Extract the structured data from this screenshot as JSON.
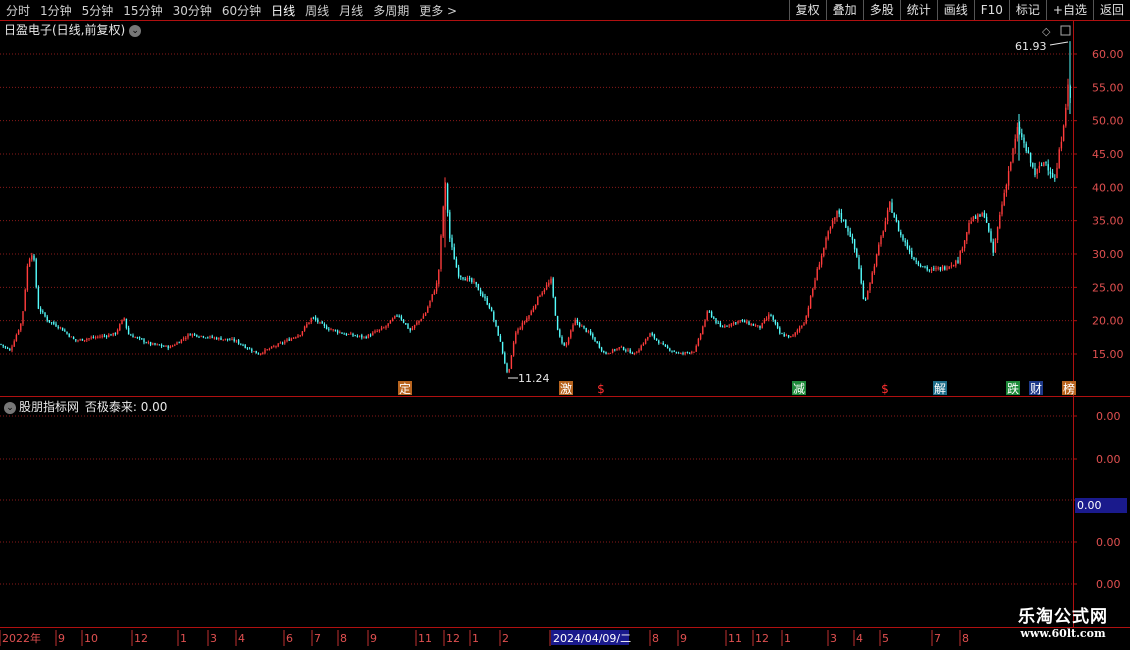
{
  "toolbar": {
    "periods": [
      "分时",
      "1分钟",
      "5分钟",
      "15分钟",
      "30分钟",
      "60分钟",
      "日线",
      "周线",
      "月线",
      "多周期",
      "更多 >"
    ],
    "active_period": "日线",
    "actions": [
      "复权",
      "叠加",
      "多股",
      "统计",
      "画线",
      "F10",
      "标记",
      "+自选",
      "返回"
    ]
  },
  "main_chart": {
    "title": "日盈电子(日线,前复权)",
    "y_ticks": [
      "60.00",
      "55.00",
      "50.00",
      "45.00",
      "40.00",
      "35.00",
      "30.00",
      "25.00",
      "20.00",
      "15.00"
    ],
    "high_label": "61.93",
    "low_label": "11.24",
    "event_markers": [
      "定",
      "激",
      "$",
      "减",
      "$",
      "解",
      "跌",
      "财",
      "榜"
    ]
  },
  "indicator": {
    "title": "股朋指标网",
    "line_label": "否极泰来: 0.00",
    "y_ticks": [
      "0.00",
      "0.00",
      "0.00",
      "0.00",
      "0.00"
    ],
    "current_value": "0.00"
  },
  "x_axis": {
    "labels": [
      "2022年",
      "9",
      "10",
      "12",
      "1",
      "3",
      "4",
      "6",
      "7",
      "8",
      "9",
      "11",
      "12",
      "1",
      "2",
      "2024/04/09/二",
      "8",
      "9",
      "11",
      "12",
      "1",
      "3",
      "4",
      "5",
      "7",
      "8"
    ]
  },
  "watermark": {
    "line1": "乐淘公式网",
    "line2": "www.60lt.com"
  },
  "colors": {
    "up": "#ff3c3c",
    "down": "#54fcfc",
    "grid": "#8a1a1a",
    "axis": "#b01010"
  },
  "chart_data": {
    "type": "candlestick",
    "ylim": [
      10,
      63
    ],
    "keypoints": [
      [
        0,
        16.5
      ],
      [
        10,
        15.5
      ],
      [
        22,
        20
      ],
      [
        28,
        29
      ],
      [
        33,
        30.5
      ],
      [
        38,
        22
      ],
      [
        48,
        20
      ],
      [
        60,
        19
      ],
      [
        75,
        17
      ],
      [
        95,
        17.5
      ],
      [
        115,
        18
      ],
      [
        124,
        20.5
      ],
      [
        128,
        18
      ],
      [
        150,
        16.5
      ],
      [
        170,
        16
      ],
      [
        190,
        18
      ],
      [
        210,
        17.5
      ],
      [
        235,
        17
      ],
      [
        258,
        15
      ],
      [
        280,
        16.5
      ],
      [
        300,
        18
      ],
      [
        312,
        20.5
      ],
      [
        325,
        19
      ],
      [
        345,
        18
      ],
      [
        365,
        17.5
      ],
      [
        385,
        19
      ],
      [
        398,
        21
      ],
      [
        410,
        18.5
      ],
      [
        425,
        21
      ],
      [
        438,
        26
      ],
      [
        445,
        41
      ],
      [
        450,
        32
      ],
      [
        458,
        27
      ],
      [
        475,
        25.5
      ],
      [
        490,
        22
      ],
      [
        500,
        17
      ],
      [
        508,
        11.5
      ],
      [
        515,
        18
      ],
      [
        530,
        21
      ],
      [
        540,
        24
      ],
      [
        551,
        26
      ],
      [
        558,
        18
      ],
      [
        565,
        16
      ],
      [
        575,
        20
      ],
      [
        590,
        18
      ],
      [
        605,
        15
      ],
      [
        620,
        16
      ],
      [
        635,
        15
      ],
      [
        650,
        18
      ],
      [
        665,
        16
      ],
      [
        680,
        15
      ],
      [
        695,
        15.5
      ],
      [
        708,
        21.5
      ],
      [
        720,
        19
      ],
      [
        740,
        20
      ],
      [
        760,
        19
      ],
      [
        770,
        21
      ],
      [
        780,
        18
      ],
      [
        792,
        17.5
      ],
      [
        805,
        20
      ],
      [
        818,
        28
      ],
      [
        828,
        33
      ],
      [
        838,
        36.5
      ],
      [
        850,
        33
      ],
      [
        858,
        29
      ],
      [
        864,
        22.5
      ],
      [
        872,
        27
      ],
      [
        882,
        33
      ],
      [
        890,
        37.5
      ],
      [
        900,
        33
      ],
      [
        915,
        29
      ],
      [
        930,
        27.5
      ],
      [
        945,
        28
      ],
      [
        958,
        29
      ],
      [
        970,
        35
      ],
      [
        985,
        36
      ],
      [
        993,
        30
      ],
      [
        1000,
        36
      ],
      [
        1008,
        42
      ],
      [
        1018,
        49
      ],
      [
        1025,
        46
      ],
      [
        1035,
        42
      ],
      [
        1045,
        44
      ],
      [
        1055,
        41
      ],
      [
        1062,
        48
      ],
      [
        1068,
        55
      ],
      [
        1072,
        52
      ]
    ]
  }
}
